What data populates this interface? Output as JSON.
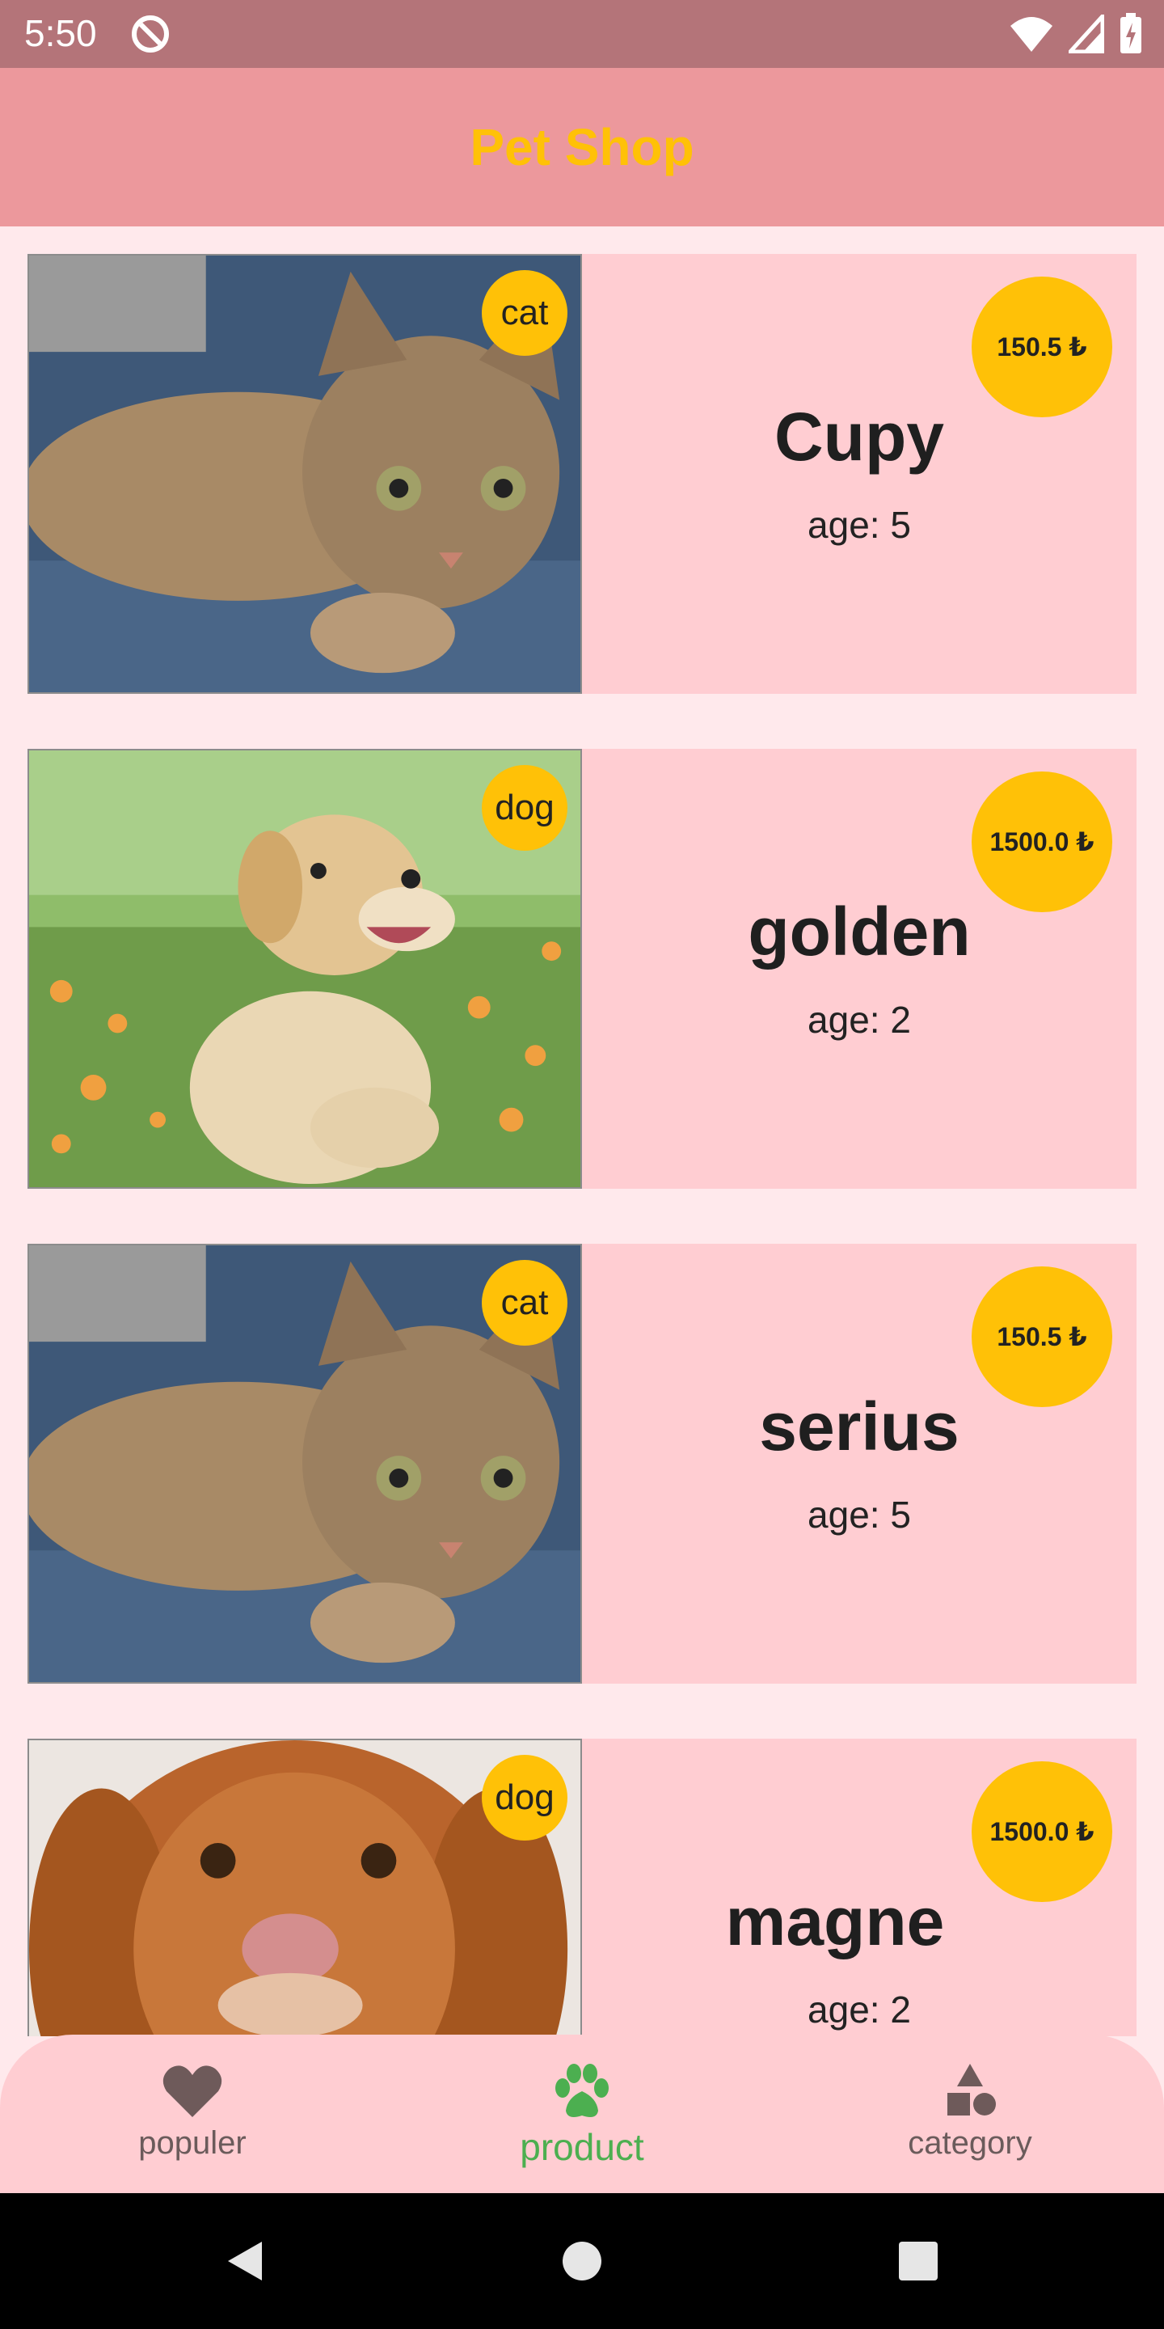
{
  "status_bar": {
    "time": "5:50"
  },
  "app_bar": {
    "title": "Pet Shop"
  },
  "pets": [
    {
      "category": "cat",
      "price": "150.5 ₺",
      "name": "Cupy",
      "age": "age: 5"
    },
    {
      "category": "dog",
      "price": "1500.0 ₺",
      "name": "golden",
      "age": "age: 2"
    },
    {
      "category": "cat",
      "price": "150.5 ₺",
      "name": "serius",
      "age": "age: 5"
    },
    {
      "category": "dog",
      "price": "1500.0 ₺",
      "name": "magne",
      "age": "age: 2"
    }
  ],
  "bottom_nav": {
    "items": [
      {
        "label": "populer",
        "icon": "heart-icon",
        "active": false
      },
      {
        "label": "product",
        "icon": "paw-icon",
        "active": true
      },
      {
        "label": "category",
        "icon": "shapes-icon",
        "active": false
      }
    ]
  },
  "colors": {
    "status_bar": "#b47479",
    "app_bar": "#ec989c",
    "accent": "#ffc107",
    "card": "#ffcdd2",
    "background": "#ffe9ec",
    "active_nav": "#4caf50"
  }
}
